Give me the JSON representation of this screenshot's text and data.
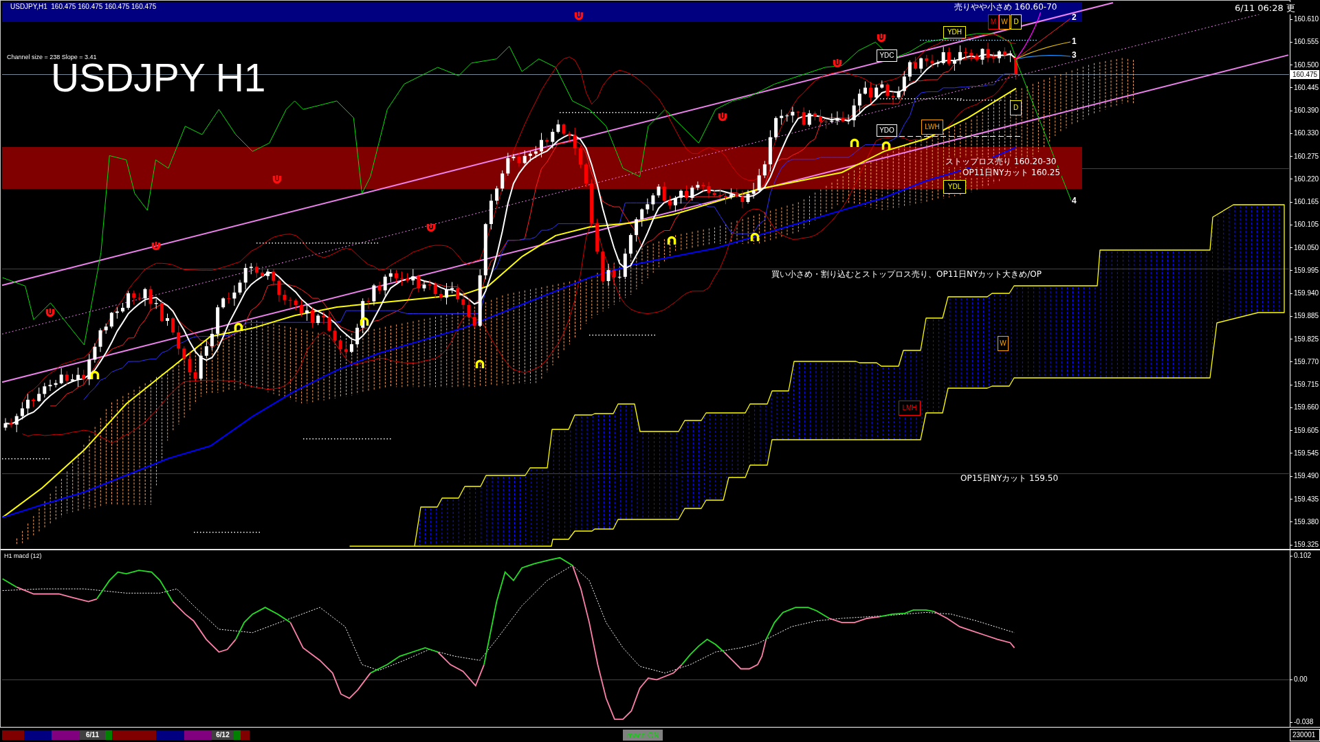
{
  "chart": {
    "header": "USDJPY,H1  160.475 160.475 160.475 160.475",
    "title": "USDJPY H1",
    "channel_info": "Channel size = 238 Slope = 3.41",
    "updated": "6/11 06:28 更",
    "zones": [
      {
        "color": "#000080",
        "notes": [
          "売りやや小さめ 160.60-70"
        ]
      },
      {
        "color": "#800000",
        "notes": [
          "ストップロス売り 160.20-30",
          "OP11日NYカット 160.25"
        ]
      }
    ],
    "line_notes": [
      "買い小さめ・割り込むとストップロス売り、OP11日NYカット大きめ/OP",
      "OP15日NYカット 159.50"
    ],
    "level_tags": [
      {
        "label": "YDH",
        "color": "#ffff00"
      },
      {
        "label": "M",
        "color": "#ff0000"
      },
      {
        "label": "W",
        "color": "#ffa500"
      },
      {
        "label": "D",
        "color": "#ffff00"
      },
      {
        "label": "YDC",
        "color": "#ffffff"
      },
      {
        "label": "YDO",
        "color": "#ffffff"
      },
      {
        "label": "LWH",
        "color": "#ffa500"
      },
      {
        "label": "D",
        "color": "#ffff00"
      },
      {
        "label": "YDL",
        "color": "#ffff00"
      },
      {
        "label": "W",
        "color": "#ffa500"
      },
      {
        "label": "LMH",
        "color": "#ff0000"
      }
    ],
    "projection_labels": [
      "2",
      "1",
      "3",
      "4"
    ]
  },
  "price_scale": {
    "ticks": [
      "160.610",
      "160.555",
      "160.500",
      "160.445",
      "160.390",
      "160.330",
      "160.275",
      "160.220",
      "160.165",
      "160.105",
      "160.050",
      "159.995",
      "159.940",
      "159.885",
      "159.825",
      "159.770",
      "159.715",
      "159.660",
      "159.605",
      "159.545",
      "159.490",
      "159.435",
      "159.380",
      "159.325"
    ],
    "current": "160.475"
  },
  "macd": {
    "title": "H1 macd (12)",
    "scale": [
      "0.102",
      "0.00",
      "-0.038"
    ]
  },
  "session_bar": [
    {
      "color": "#800000"
    },
    {
      "color": "#000080"
    },
    {
      "color": "#800080"
    },
    {
      "color": "#404040",
      "label": "6/11"
    },
    {
      "color": "#008000"
    },
    {
      "color": "#800000"
    },
    {
      "color": "#000080"
    },
    {
      "color": "#800080"
    },
    {
      "color": "#404040",
      "label": "6/12"
    },
    {
      "color": "#008000"
    },
    {
      "color": "#800000"
    }
  ],
  "toggle": "macd ON",
  "status": "230001"
}
